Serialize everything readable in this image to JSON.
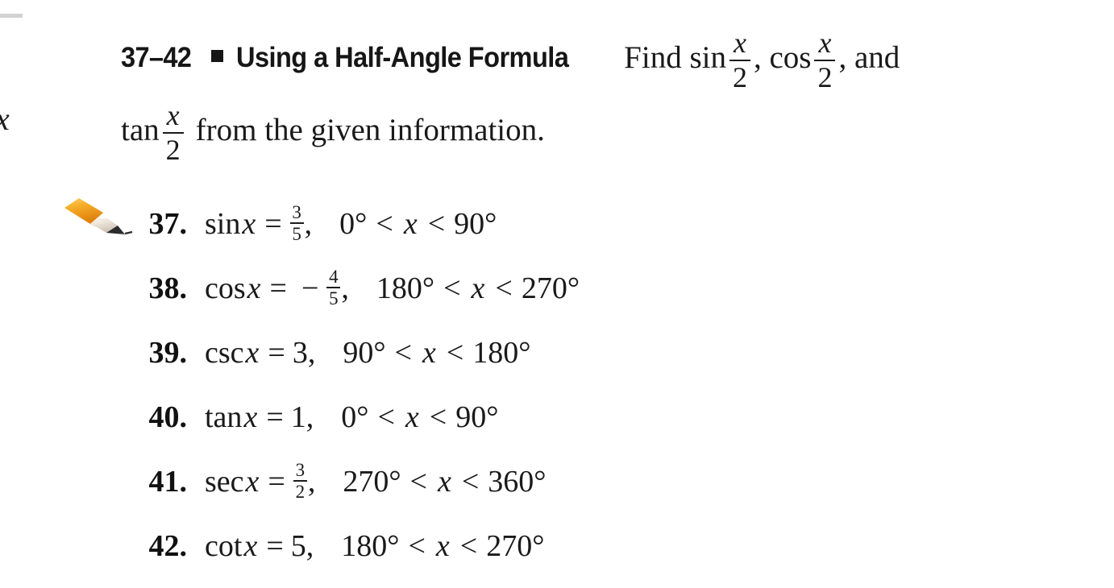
{
  "page": {
    "margin_artifacts": {
      "stray_x": "x",
      "rule_color": "#d2d2d4"
    }
  },
  "intro": {
    "range_label": "37–42",
    "bullet": "square-bullet",
    "title": "Using a Half-Angle Formula",
    "prose_1": "Find sin",
    "prose_2": ", cos",
    "prose_3": ", and",
    "prose_4": "tan",
    "prose_5": "from the given information.",
    "fraction": {
      "numerator": "x",
      "denominator": "2"
    }
  },
  "exercises": [
    {
      "number": "37.",
      "marker": "pencil-icon",
      "func": "sin",
      "var": "x",
      "equals": "=",
      "value_type": "fraction",
      "value_num": "3",
      "value_den": "5",
      "comma": ",",
      "lower": "0°",
      "rel1": "<",
      "cond_var": "x",
      "rel2": "<",
      "upper": "90°"
    },
    {
      "number": "38.",
      "marker": "",
      "func": "cos",
      "var": "x",
      "equals": "=",
      "value_type": "fraction",
      "sign": "−",
      "value_num": "4",
      "value_den": "5",
      "comma": ",",
      "lower": "180°",
      "rel1": "<",
      "cond_var": "x",
      "rel2": "<",
      "upper": "270°"
    },
    {
      "number": "39.",
      "marker": "",
      "func": "csc",
      "var": "x",
      "equals": "=",
      "value_type": "integer",
      "value": "3",
      "comma": ",",
      "lower": "90°",
      "rel1": "<",
      "cond_var": "x",
      "rel2": "<",
      "upper": "180°"
    },
    {
      "number": "40.",
      "marker": "",
      "func": "tan",
      "var": "x",
      "equals": "=",
      "value_type": "integer",
      "value": "1",
      "comma": ",",
      "lower": "0°",
      "rel1": "<",
      "cond_var": "x",
      "rel2": "<",
      "upper": "90°"
    },
    {
      "number": "41.",
      "marker": "",
      "func": "sec",
      "var": "x",
      "equals": "=",
      "value_type": "fraction",
      "value_num": "3",
      "value_den": "2",
      "comma": ",",
      "lower": "270°",
      "rel1": "<",
      "cond_var": "x",
      "rel2": "<",
      "upper": "360°"
    },
    {
      "number": "42.",
      "marker": "",
      "func": "cot",
      "var": "x",
      "equals": "=",
      "value_type": "integer",
      "value": "5",
      "comma": ",",
      "lower": "180°",
      "rel1": "<",
      "cond_var": "x",
      "rel2": "<",
      "upper": "270°"
    }
  ],
  "colors": {
    "text": "#1a1a1a",
    "pencil_body_light": "#f7b733",
    "pencil_body_dark": "#e0890f",
    "pencil_wood": "#f2ece4",
    "pencil_tip": "#2b2b2b",
    "margin_rule": "#d2d2d4"
  }
}
